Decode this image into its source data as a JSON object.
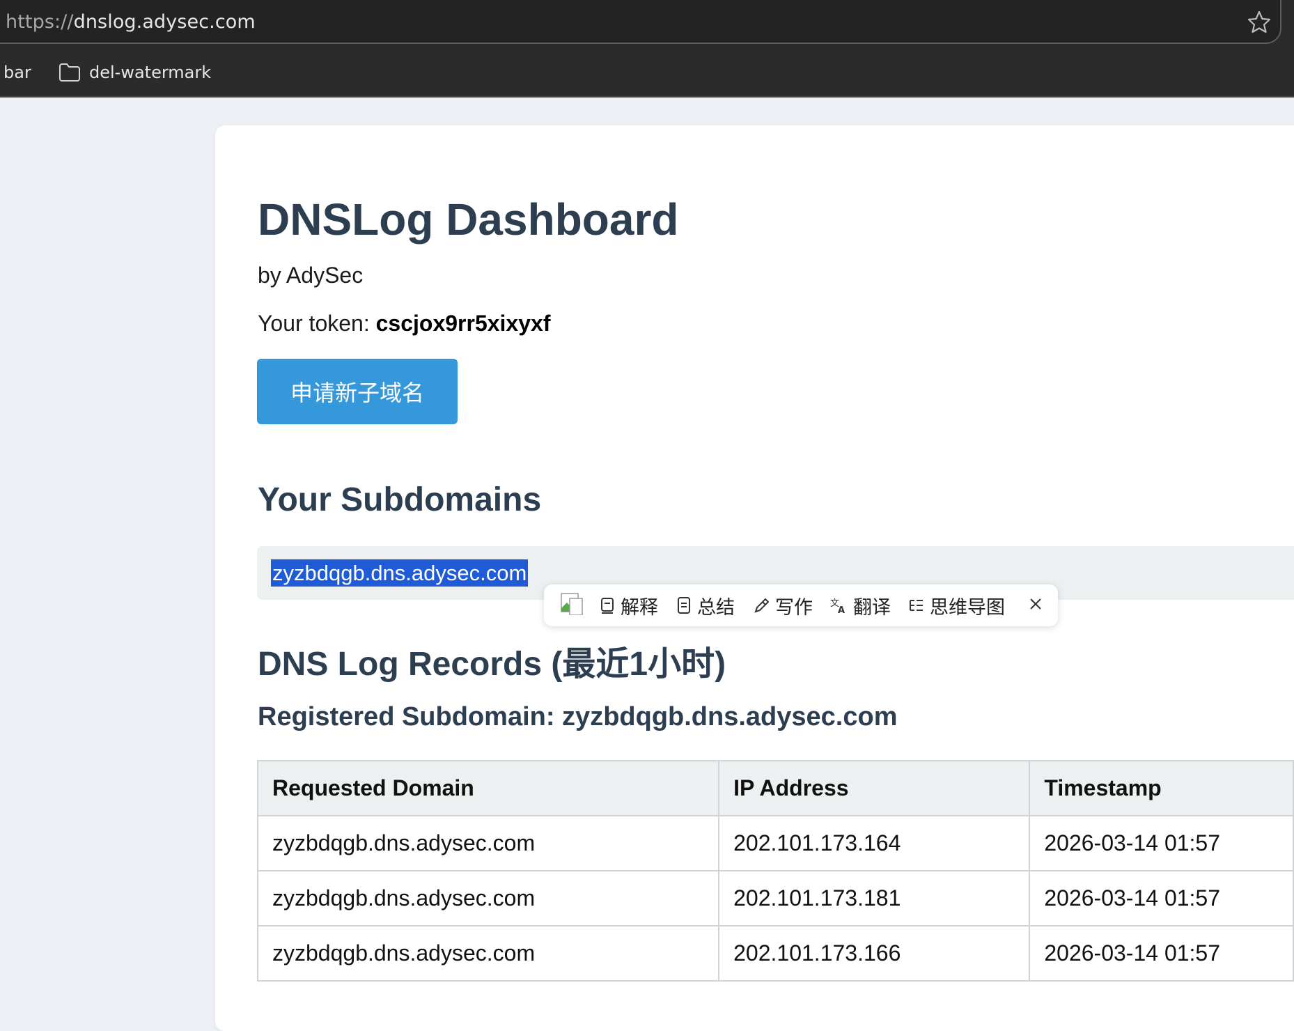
{
  "browser": {
    "url_protocol": "https://",
    "url_host": "dnslog.adysec.com",
    "bookmarks": [
      "bar",
      "del-watermark"
    ]
  },
  "page": {
    "title": "DNSLog Dashboard",
    "byline": "by AdySec",
    "token_label": "Your token: ",
    "token_value": "cscjox9rr5xixyxf",
    "apply_button": "申请新子域名",
    "subdomains_heading": "Your Subdomains",
    "subdomain": "zyzbdqgb.dns.adysec.com",
    "records_heading": "DNS Log Records (最近1小时)",
    "registered_subdomain": "Registered Subdomain: zyzbdqgb.dns.adysec.com",
    "accent_color": "#3498db",
    "heading_color": "#2c3e50"
  },
  "table": {
    "headers": [
      "Requested Domain",
      "IP Address",
      "Timestamp"
    ],
    "rows": [
      [
        "zyzbdqgb.dns.adysec.com",
        "202.101.173.164",
        "2026-03-14 01:57"
      ],
      [
        "zyzbdqgb.dns.adysec.com",
        "202.101.173.181",
        "2026-03-14 01:57"
      ],
      [
        "zyzbdqgb.dns.adysec.com",
        "202.101.173.166",
        "2026-03-14 01:57"
      ]
    ]
  },
  "selection_toolbar": {
    "items": [
      "解释",
      "总结",
      "写作",
      "翻译",
      "思维导图"
    ],
    "icons": [
      "explain-icon",
      "summary-icon",
      "write-icon",
      "translate-icon",
      "mindmap-icon",
      "close-icon"
    ]
  }
}
